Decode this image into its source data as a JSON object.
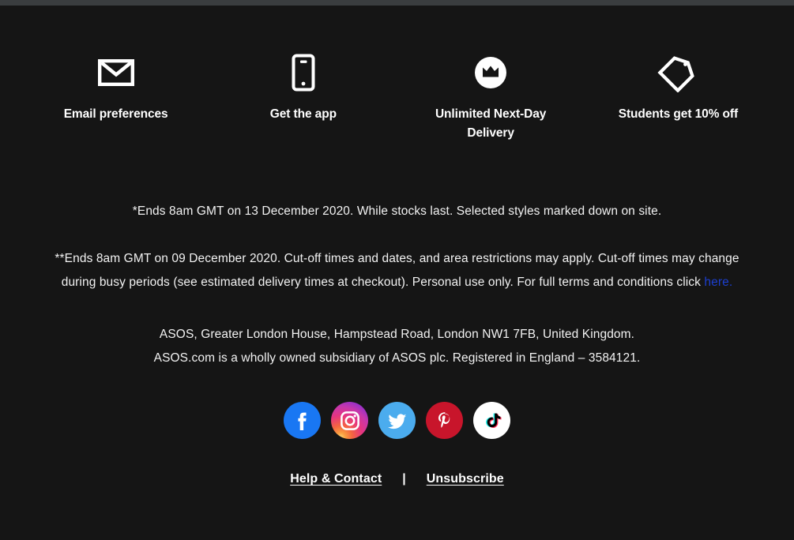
{
  "page": {
    "background_color": "#151515",
    "text_color": "#ffffff",
    "link_color": "#1c3fcf"
  },
  "benefits": [
    {
      "icon": "envelope-icon",
      "label": "Email preferences"
    },
    {
      "icon": "mobile-phone-icon",
      "label": "Get the app"
    },
    {
      "icon": "crown-badge-icon",
      "label": "Unlimited Next-Day Delivery"
    },
    {
      "icon": "price-tag-icon",
      "label": "Students get 10% off"
    }
  ],
  "legal": {
    "paragraph_one": "*Ends 8am GMT on 13 December 2020. While stocks last. Selected styles marked down on site.",
    "paragraph_two_before_link": "**Ends 8am GMT on 09 December 2020. Cut-off times and dates, and area restrictions may apply. Cut-off times may change during busy periods (see estimated delivery times at checkout). Personal use only. For full terms and conditions click ",
    "paragraph_two_link": "here."
  },
  "address": {
    "line_one": "ASOS, Greater London House, Hampstead Road, London NW1 7FB, United Kingdom.",
    "line_two": "ASOS.com is a wholly owned subsidiary of ASOS plc. Registered in England – 3584121."
  },
  "social": [
    {
      "name": "facebook-icon",
      "label": "Facebook",
      "color": "#1977f3"
    },
    {
      "name": "instagram-icon",
      "label": "Instagram",
      "color": "#e6357f"
    },
    {
      "name": "twitter-icon",
      "label": "Twitter",
      "color": "#4bacee"
    },
    {
      "name": "pinterest-icon",
      "label": "Pinterest",
      "color": "#c8152b"
    },
    {
      "name": "tiktok-icon",
      "label": "TikTok",
      "color": "#ffffff"
    }
  ],
  "bottom_links": {
    "help": "Help & Contact ",
    "divider": "|",
    "unsubscribe": "Unsubscribe"
  }
}
